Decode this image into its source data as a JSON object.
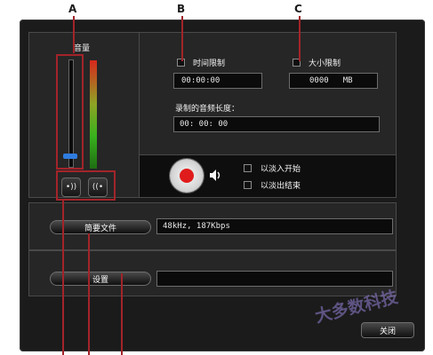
{
  "callouts": [
    "A",
    "B",
    "C"
  ],
  "volume": {
    "label": "音量",
    "level": 0.05
  },
  "time_limit": {
    "label": "时间限制",
    "value": "00:00:00"
  },
  "size_limit": {
    "label": "大小限制",
    "value": "0000",
    "unit": "MB"
  },
  "record_length": {
    "label": "录制的音频长度：",
    "value": "00: 00: 00"
  },
  "record": {
    "fade_in_label": "以淡入开始",
    "fade_out_label": "以淡出结束"
  },
  "summary": {
    "button": "简要文件",
    "value": "48kHz, 187Kbps"
  },
  "settings": {
    "button": "设置",
    "value": ""
  },
  "close_button": "关闭",
  "watermark": "大多数科技",
  "colors": {
    "record_red": "#e01b1b",
    "meter_green": "#38b11d",
    "meter_red": "#d8281d",
    "callout_line": "#a3242a",
    "slider_blue": "#2f7ce0"
  },
  "icons": [
    "record-icon",
    "speaker-icon",
    "broadcast-out-icon",
    "broadcast-in-icon"
  ]
}
